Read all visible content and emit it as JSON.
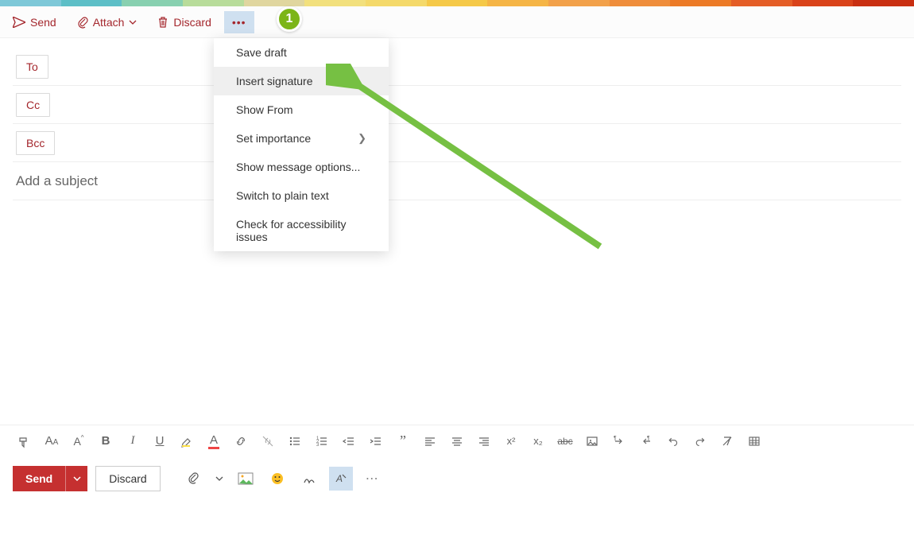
{
  "colors": {
    "accent": "#a4262c",
    "send_btn": "#c53030",
    "step_badge": "#7cb518",
    "highlight_bg": "#cfe0f0"
  },
  "rainbow": [
    "#7ec8d8",
    "#5dbfc7",
    "#88d0b0",
    "#b8dc9a",
    "#e0d69f",
    "#f2e07d",
    "#f4d96a",
    "#f5c948",
    "#f5b546",
    "#f2a14a",
    "#ef8d3b",
    "#ec7a26",
    "#e45d26",
    "#d9421a",
    "#c92f11"
  ],
  "top_toolbar": {
    "send": "Send",
    "attach": "Attach",
    "discard": "Discard"
  },
  "fields": {
    "to": "To",
    "cc": "Cc",
    "bcc": "Bcc",
    "subject_placeholder": "Add a subject"
  },
  "dropdown": {
    "items": [
      {
        "label": "Save draft",
        "submenu": false
      },
      {
        "label": "Insert signature",
        "submenu": false,
        "highlighted": true
      },
      {
        "label": "Show From",
        "submenu": false
      },
      {
        "label": "Set importance",
        "submenu": true
      },
      {
        "label": "Show message options...",
        "submenu": false
      },
      {
        "label": "Switch to plain text",
        "submenu": false
      },
      {
        "label": "Check for accessibility issues",
        "submenu": false
      }
    ]
  },
  "format_toolbar": {
    "bold": "B",
    "italic": "I",
    "underline": "U",
    "font_color": "A",
    "quote": "”",
    "super": "x²",
    "sub": "x₂",
    "strike": "abc"
  },
  "bottom_bar": {
    "send": "Send",
    "discard": "Discard",
    "more": "⋯"
  },
  "annotation": {
    "step": "1"
  }
}
